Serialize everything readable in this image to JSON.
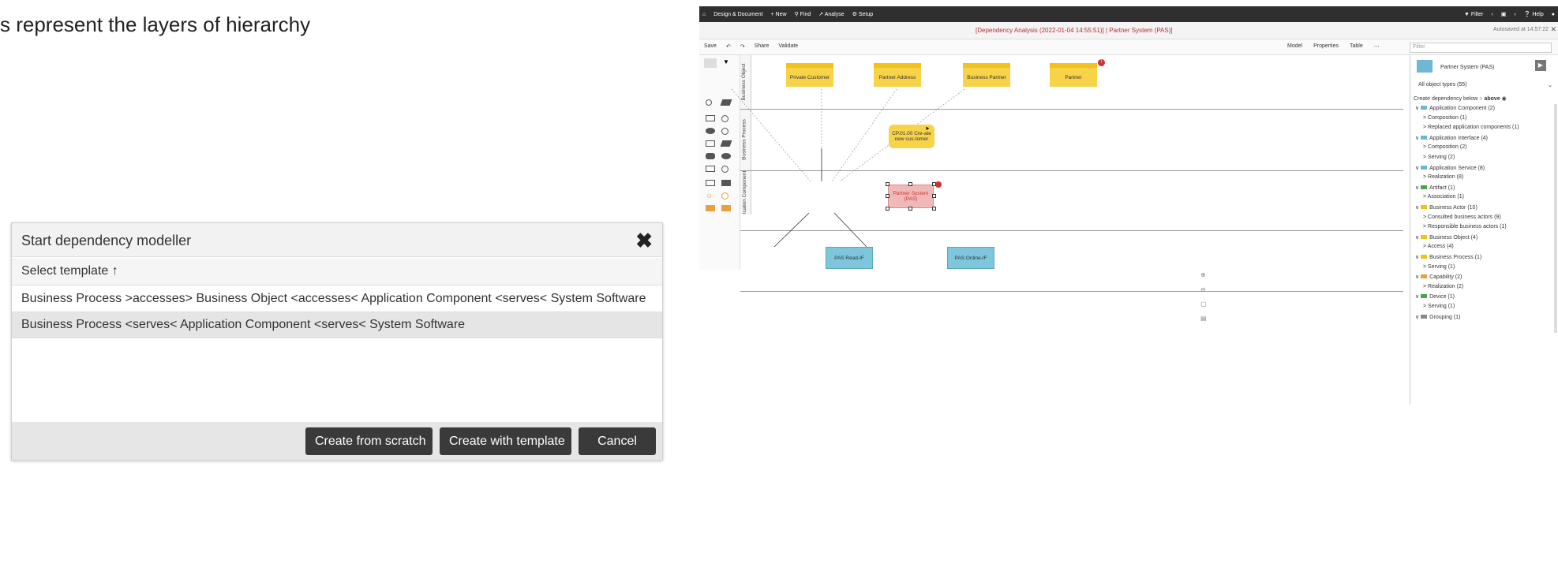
{
  "caption": "s represent the layers of hierarchy",
  "app": {
    "topnav": {
      "items": [
        "Design & Document",
        "New",
        "Find",
        "Analyse",
        "Setup"
      ]
    },
    "topright": {
      "filter": "Filter",
      "help": "Help"
    },
    "title": "[Dependency Analysis (2022-01-04 14:55:51)] | Partner System (PAS)]",
    "autosaved": "Autosaved at 14:57:22",
    "toolbar": {
      "save": "Save",
      "share": "Share",
      "validate": "Validate"
    },
    "view_tabs": [
      "Model",
      "Properties",
      "Table"
    ],
    "filter_placeholder": "Filter",
    "lanes": [
      "Business Object",
      "Business Process",
      "Ication Component"
    ],
    "business_objects": [
      "Private Customer",
      "Partner Address",
      "Business Partner",
      "Partner"
    ],
    "process": "CP.01.00 Cre-ate new cus-tomer",
    "system": "Partner System (PAS)",
    "interfaces": [
      "PAS Read-IF",
      "PAS Online-IF"
    ],
    "panel": {
      "object": "Partner System (PAS)",
      "types": "All object types (55)",
      "dependency": "Create dependency below",
      "above": "above",
      "tree": [
        {
          "label": "Application Component (2)",
          "level": 0,
          "color": "#6fb7d6"
        },
        {
          "label": "Composition (1)",
          "level": 1
        },
        {
          "label": "Replaced application components (1)",
          "level": 1
        },
        {
          "label": "Application Interface (4)",
          "level": 0,
          "color": "#6fb7d6"
        },
        {
          "label": "Composition (2)",
          "level": 1
        },
        {
          "label": "Serving (2)",
          "level": 1
        },
        {
          "label": "Application Service (8)",
          "level": 0,
          "color": "#6fb7d6"
        },
        {
          "label": "Realization (8)",
          "level": 1
        },
        {
          "label": "Artifact (1)",
          "level": 0,
          "color": "#4aa64a"
        },
        {
          "label": "Association (1)",
          "level": 1
        },
        {
          "label": "Business Actor (10)",
          "level": 0,
          "color": "#f2c21a"
        },
        {
          "label": "Consulted business actors (9)",
          "level": 1
        },
        {
          "label": "Responsible business actors (1)",
          "level": 1
        },
        {
          "label": "Business Object (4)",
          "level": 0,
          "color": "#f2c21a"
        },
        {
          "label": "Access (4)",
          "level": 1
        },
        {
          "label": "Business Process (1)",
          "level": 0,
          "color": "#f2c21a"
        },
        {
          "label": "Serving (1)",
          "level": 1
        },
        {
          "label": "Capability (2)",
          "level": 0,
          "color": "#e8a040"
        },
        {
          "label": "Realization (2)",
          "level": 1
        },
        {
          "label": "Device (1)",
          "level": 0,
          "color": "#4aa64a"
        },
        {
          "label": "Serving (1)",
          "level": 1
        },
        {
          "label": "Grouping (1)",
          "level": 0,
          "color": "#888888"
        }
      ]
    }
  },
  "dialog": {
    "title": "Start dependency modeller",
    "subheader": "Select template ↑",
    "templates": [
      "Business Process >accesses> Business Object <accesses< Application Component <serves< System Software",
      "Business Process <serves< Application Component <serves< System Software"
    ],
    "buttons": {
      "scratch": "Create from scratch",
      "template": "Create with template",
      "cancel": "Cancel"
    }
  }
}
